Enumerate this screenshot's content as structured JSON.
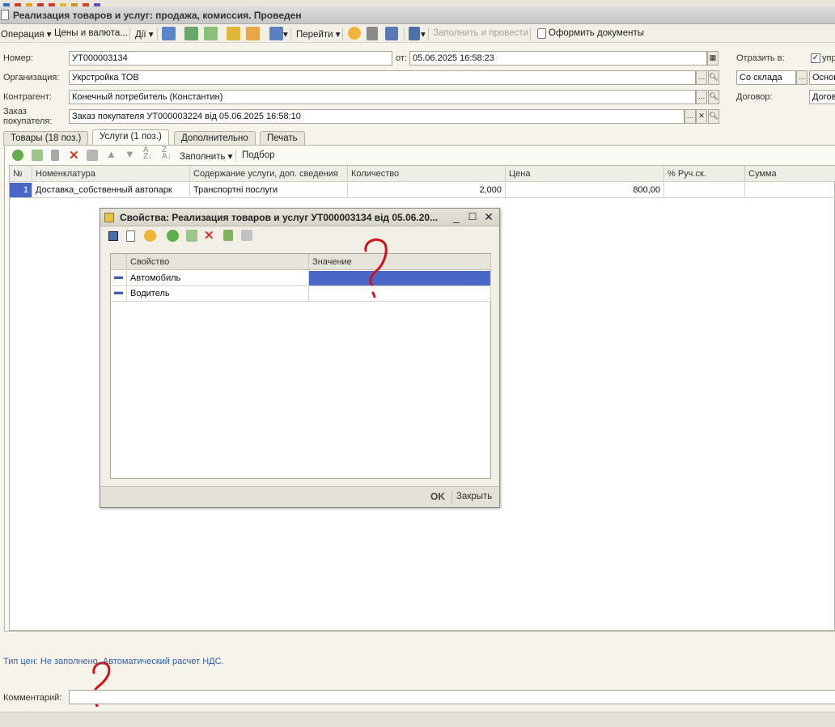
{
  "window": {
    "title": "Реализация товаров и услуг: продажа, комиссия. Проведен"
  },
  "toolbar": {
    "operation": "Операция",
    "prices": "Цены и валюта...",
    "actions": "Дії",
    "goto": "Перейти",
    "fill_post": "Заполнить и провести",
    "make_docs": "Оформить документы"
  },
  "form": {
    "number_label": "Номер:",
    "number_value": "УТ000003134",
    "date_label": "от:",
    "date_value": "05.06.2025 16:58:23",
    "org_label": "Организация:",
    "org_value": "Укрстройка ТОВ",
    "contractor_label": "Контрагент:",
    "contractor_value": "Конечный потребитель (Константин)",
    "order_label": "Заказ покупателя:",
    "order_value": "Заказ покупателя УТ000003224 від 05.06.2025 16:58:10",
    "reflect_label": "Отразить в:",
    "reflect_check_label": "упр",
    "warehouse_value": "Со склада",
    "warehouse2_value": "Основ",
    "contract_label": "Договор:",
    "contract_value": "Догов"
  },
  "tabs": [
    {
      "label": "Товары (18 поз.)"
    },
    {
      "label": "Услуги (1 поз.)"
    },
    {
      "label": "Дополнительно"
    },
    {
      "label": "Печать"
    }
  ],
  "grid_toolbar": {
    "fill": "Заполнить",
    "select": "Подбор"
  },
  "grid": {
    "headers": [
      "№",
      "Номенклатура",
      "Содержание услуги, доп. сведения",
      "Количество",
      "Цена",
      "% Руч.ск.",
      "Сумма"
    ],
    "rows": [
      {
        "num": "1",
        "item": "Доставка_собственный автопарк",
        "content": "Транспортні послуги",
        "qty": "2,000",
        "price": "800,00",
        "disc": "",
        "sum": ""
      }
    ]
  },
  "dialog": {
    "title": "Свойства: Реализация товаров и услуг УТ000003134 від 05.06.20...",
    "headers": [
      "Свойство",
      "Значение"
    ],
    "rows": [
      {
        "property": "Автомобиль",
        "value": ""
      },
      {
        "property": "Водитель",
        "value": ""
      }
    ],
    "ok": "OK",
    "close": "Закрыть"
  },
  "footer": {
    "price_type_text": "Тип цен: Не заполнено, Автоматический расчет НДС.",
    "comment_label": "Комментарий:",
    "comment_value": ""
  },
  "colors": {
    "selection": "#4a67c7",
    "link": "#2f5fb8",
    "scribble": "#d0121b"
  }
}
